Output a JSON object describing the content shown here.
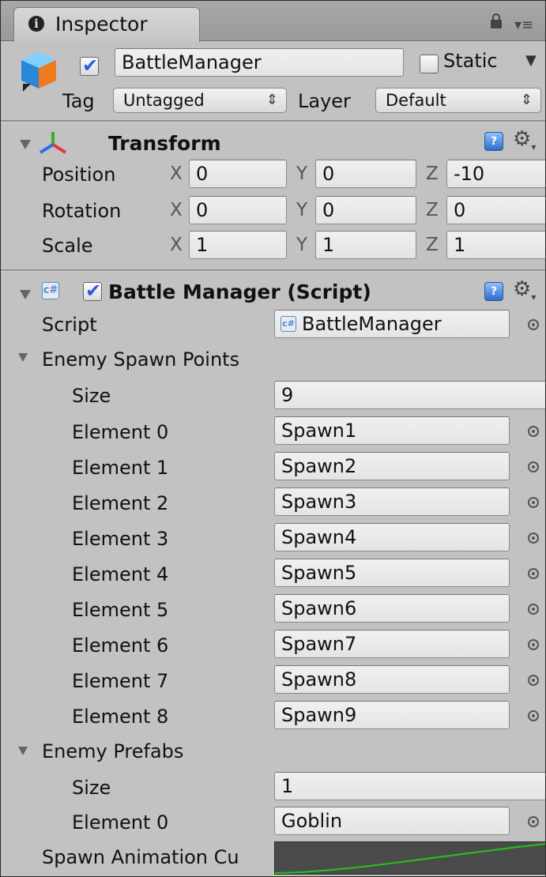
{
  "tab": {
    "title": "Inspector",
    "info_icon": "i"
  },
  "header": {
    "object_name": "BattleManager",
    "active_checked": true,
    "static_label": "Static",
    "static_checked": false,
    "tag_label": "Tag",
    "tag_value": "Untagged",
    "layer_label": "Layer",
    "layer_value": "Default"
  },
  "transform": {
    "title": "Transform",
    "rows": [
      {
        "label": "Position",
        "x": "0",
        "y": "0",
        "z": "-10"
      },
      {
        "label": "Rotation",
        "x": "0",
        "y": "0",
        "z": "0"
      },
      {
        "label": "Scale",
        "x": "1",
        "y": "1",
        "z": "1"
      }
    ],
    "axis": {
      "x": "X",
      "y": "Y",
      "z": "Z"
    }
  },
  "component": {
    "title": "Battle Manager (Script)",
    "enabled": true,
    "script_label": "Script",
    "script_value": "BattleManager",
    "spawn_points": {
      "label": "Enemy Spawn Points",
      "size_label": "Size",
      "size_value": "9",
      "elements": [
        {
          "label": "Element 0",
          "value": "Spawn1"
        },
        {
          "label": "Element 1",
          "value": "Spawn2"
        },
        {
          "label": "Element 2",
          "value": "Spawn3"
        },
        {
          "label": "Element 3",
          "value": "Spawn4"
        },
        {
          "label": "Element 4",
          "value": "Spawn5"
        },
        {
          "label": "Element 5",
          "value": "Spawn6"
        },
        {
          "label": "Element 6",
          "value": "Spawn7"
        },
        {
          "label": "Element 7",
          "value": "Spawn8"
        },
        {
          "label": "Element 8",
          "value": "Spawn9"
        }
      ]
    },
    "prefabs": {
      "label": "Enemy Prefabs",
      "size_label": "Size",
      "size_value": "1",
      "elements": [
        {
          "label": "Element 0",
          "value": "Goblin"
        }
      ]
    },
    "curve_label": "Spawn Animation Cu",
    "curve_color": "#22c41a"
  },
  "icons": {
    "cube": "gameobject-cube-icon",
    "transform": "transform-axes-icon",
    "help": "help-book-icon",
    "gear": "gear-icon",
    "picker": "object-picker-icon",
    "lock": "lock-icon",
    "menu": "tab-menu-icon",
    "help_glyph": "?",
    "gear_glyph": "⚙",
    "script_glyph": "c#"
  }
}
